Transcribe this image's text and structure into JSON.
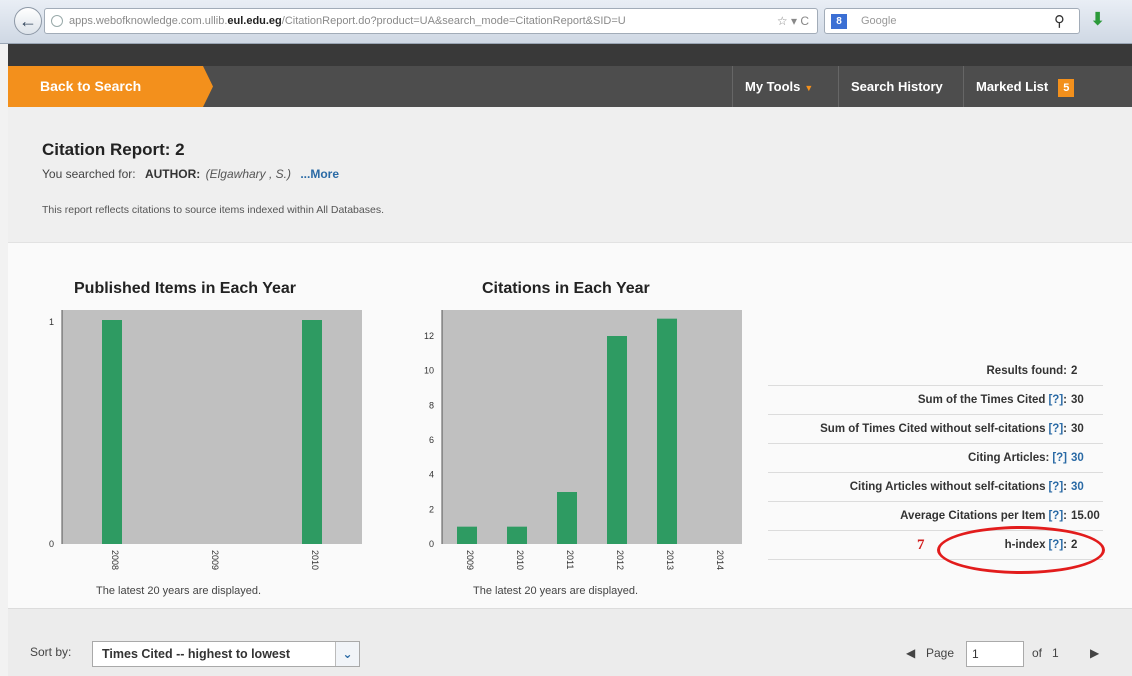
{
  "browser": {
    "url_prefix": "apps.webofknowledge.com.ullib.",
    "url_domain": "eul.edu.eg",
    "url_rest": "/CitationReport.do?product=UA&search_mode=CitationReport&SID=U",
    "url_controls": "☆ ▾ C",
    "search_engine_label": "Google",
    "back_icon": "back-arrow-icon",
    "search_icon": "magnifier-icon",
    "download_icon": "download-arrow-icon"
  },
  "nav": {
    "back_to_search": "Back to Search",
    "my_tools": "My Tools",
    "search_history": "Search History",
    "marked_list": "Marked List",
    "marked_count": "5",
    "accent": "#f3901c"
  },
  "report": {
    "title": "Citation Report: 2",
    "searched_for_label": "You searched for:",
    "author_label": "AUTHOR:",
    "query": "(Elgawhary , S.)",
    "more_link": "...More",
    "reflects": "This report reflects citations to source items indexed within All Databases."
  },
  "charts": {
    "published_title": "Published Items in Each Year",
    "citations_title": "Citations in Each Year",
    "published_note": "The latest 20 years are displayed.",
    "citations_note": "The latest 20 years are displayed."
  },
  "chart_data": [
    {
      "type": "bar",
      "title": "Published Items in Each Year",
      "categories": [
        "2008",
        "2009",
        "2010"
      ],
      "values": [
        1,
        0,
        1
      ],
      "y_ticks": [
        "0",
        "1"
      ],
      "ylim": [
        0,
        1
      ],
      "bar_color": "#2e9b62",
      "plot_bg": "#c0c0c0"
    },
    {
      "type": "bar",
      "title": "Citations in Each Year",
      "categories": [
        "2009",
        "2010",
        "2011",
        "2012",
        "2013",
        "2014"
      ],
      "values": [
        1,
        1,
        3,
        12,
        13,
        0
      ],
      "y_ticks": [
        "0",
        "2",
        "4",
        "6",
        "8",
        "10",
        "12"
      ],
      "ylim": [
        0,
        13.5
      ],
      "bar_color": "#2e9b62",
      "plot_bg": "#c0c0c0"
    }
  ],
  "stats": {
    "results_found_label": "Results found:",
    "results_found_value": "2",
    "sum_times_cited_label": "Sum of the Times Cited",
    "sum_times_cited_value": "30",
    "sum_without_self_label": "Sum of Times Cited without self-citations",
    "sum_without_self_value": "30",
    "citing_articles_label": "Citing Articles:",
    "citing_articles_value": "30",
    "citing_without_self_label": "Citing Articles without self-citations",
    "citing_without_self_value": "30",
    "avg_citations_label": "Average Citations per Item",
    "avg_citations_value": "15.00",
    "h_index_label": "h-index",
    "h_index_value": "2",
    "help_marker": "[?]",
    "colon": ":"
  },
  "annotation": {
    "number": "7",
    "color": "#e21c1c"
  },
  "footer": {
    "sort_label": "Sort by:",
    "sort_value": "Times Cited -- highest to lowest",
    "page_label": "Page",
    "page_value": "1",
    "of_label": "of",
    "total_pages": "1"
  }
}
